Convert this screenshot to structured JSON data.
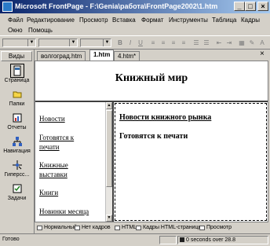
{
  "window": {
    "title": "Microsoft FrontPage - F:\\Genia\\работа\\FrontPage2002\\1.htm"
  },
  "menu": {
    "items": [
      "Файл",
      "Редактирование",
      "Просмотр",
      "Вставка",
      "Формат",
      "Инструменты",
      "Таблица",
      "Кадры",
      "Окно",
      "Помощь"
    ]
  },
  "sidebar": {
    "header": "Виды",
    "items": [
      {
        "label": "Страница",
        "icon": "page-view-icon"
      },
      {
        "label": "Папки",
        "icon": "folders-view-icon"
      },
      {
        "label": "Отчеты",
        "icon": "reports-view-icon"
      },
      {
        "label": "Навигация",
        "icon": "navigation-view-icon"
      },
      {
        "label": "Гиперсс...",
        "icon": "hyperlinks-view-icon"
      },
      {
        "label": "Задачи",
        "icon": "tasks-view-icon"
      }
    ]
  },
  "tabs": [
    "волгоград.htm",
    "1.htm",
    "4.htm*"
  ],
  "document": {
    "heading": "Книжный мир",
    "left_links": [
      "Новости",
      "Готовятся к",
      "печати",
      "Книжные",
      "выставки",
      "Книги",
      "Новинки месяца"
    ],
    "right_link": "Новости книжного рынка",
    "right_text": "Готовятся к печати"
  },
  "view_tabs": [
    "Нормальный",
    "Нет кадров",
    "HTML",
    "Кадры HTML-страницы",
    "Просмотр"
  ],
  "status": {
    "left": "Готово",
    "right": "0 seconds over 28.8"
  },
  "colors": {
    "title_start": "#0a246a",
    "title_end": "#a6caf0"
  }
}
